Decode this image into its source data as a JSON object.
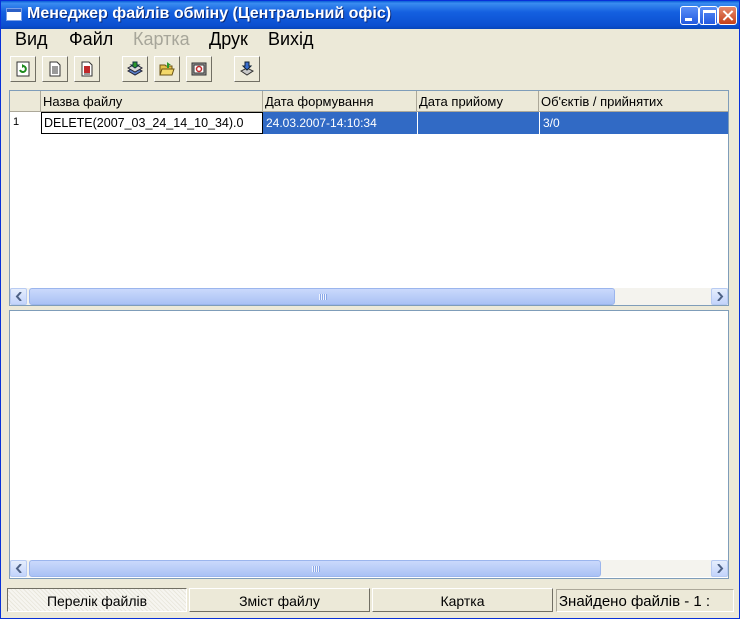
{
  "window": {
    "title": "Менеджер файлів обміну (Центральний офіс)"
  },
  "menu": {
    "items": [
      {
        "label": "Вид",
        "enabled": true
      },
      {
        "label": "Файл",
        "enabled": true
      },
      {
        "label": "Картка",
        "enabled": false
      },
      {
        "label": "Друк",
        "enabled": true
      },
      {
        "label": "Вихід",
        "enabled": true
      }
    ]
  },
  "toolbar": {
    "buttons": [
      {
        "icon": "refresh-icon"
      },
      {
        "icon": "document-icon"
      },
      {
        "icon": "document-red-icon"
      },
      {
        "icon": "stack-icon"
      },
      {
        "icon": "folder-open-icon"
      },
      {
        "icon": "print-preview-icon"
      },
      {
        "icon": "export-icon"
      }
    ]
  },
  "grid": {
    "columns": [
      "",
      "Назва файлу",
      "Дата формування",
      "Дата прийому",
      "Об'єктів / прийнятих"
    ],
    "rows": [
      {
        "num": "1",
        "name": "DELETE(2007_03_24_14_10_34).0",
        "created": "24.03.2007-14:10:34",
        "received": "",
        "objects": "3/0",
        "selected": true
      }
    ]
  },
  "status": {
    "tabs": [
      {
        "label": "Перелік файлів",
        "active": true
      },
      {
        "label": "Зміст файлу",
        "active": false
      },
      {
        "label": "Картка",
        "active": false
      }
    ],
    "text": "Знайдено файлів   -   1 :"
  },
  "colors": {
    "titlebar": "#0b4fd0",
    "selection": "#316ac5",
    "face": "#ece9d8"
  }
}
